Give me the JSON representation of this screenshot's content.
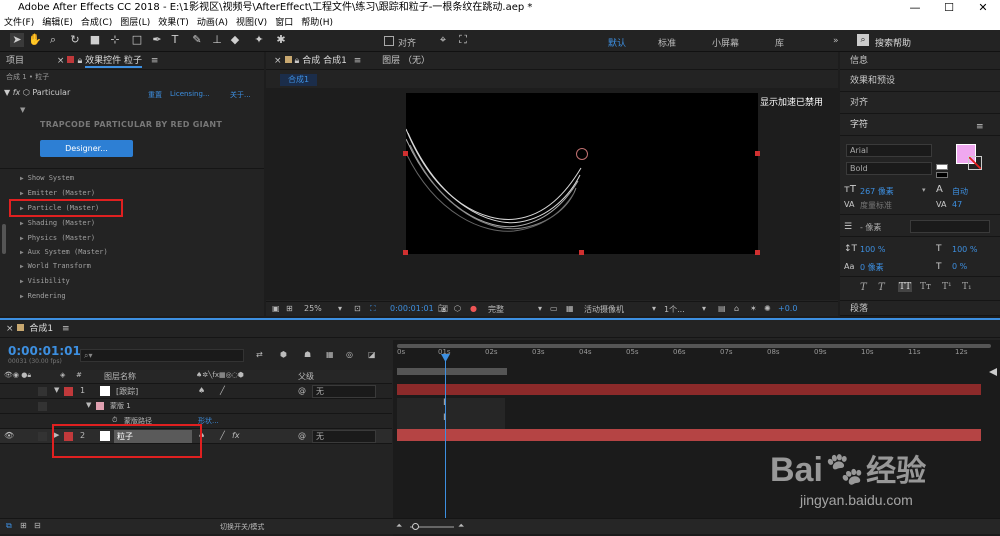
{
  "window": {
    "title": "Adobe After Effects CC 2018 - E:\\1影视区\\视频号\\AfterEffect\\工程文件\\练习\\跟踪和粒子-一根条纹在跳动.aep *",
    "app_icon": "Ae"
  },
  "menu": [
    "文件(F)",
    "编辑(E)",
    "合成(C)",
    "图层(L)",
    "效果(T)",
    "动画(A)",
    "视图(V)",
    "窗口",
    "帮助(H)"
  ],
  "toolbar": {
    "align_label": "对齐",
    "workspaces": [
      "默认",
      "标准",
      "小屏幕",
      "库"
    ],
    "search_placeholder": "搜索帮助"
  },
  "left_panel": {
    "tabs": [
      "项目",
      "效果控件 粒子"
    ],
    "breadcrumb": "合成 1 • 粒子",
    "effect_name": "Particular",
    "effect_links": [
      "重置",
      "Licensing...",
      "关于..."
    ],
    "brand": "TRAPCODE PARTICULAR BY RED GIANT",
    "designer_btn": "Designer...",
    "groups": [
      "Show System",
      "Emitter (Master)",
      "Particle (Master)",
      "Shading (Master)",
      "Physics (Master)",
      "Aux System (Master)",
      "World Transform",
      "Visibility",
      "Rendering"
    ]
  },
  "comp_panel": {
    "tab": "合成 合成1",
    "layer_tab": "图层 （无）",
    "sub_tab": "合成1",
    "notice": "显示加速已禁用",
    "zoom": "25%",
    "time": "0:00:01:01",
    "quality": "完整",
    "camera": "活动摄像机",
    "views": "1个...",
    "exposure": "+0.0"
  },
  "right_panel": {
    "items": [
      "信息",
      "效果和预设",
      "对齐",
      "字符"
    ],
    "font": "Arial",
    "style": "Bold",
    "size": "267 像素",
    "leading": "自动",
    "tracking_label": "度量标准",
    "tracking": "47",
    "stroke": "- 像素",
    "vscale": "100 %",
    "hscale": "100 %",
    "baseline": "0 像素",
    "tsume": "0 %",
    "paragraph": "段落",
    "style_btns": [
      "T",
      "T",
      "TT",
      "Tт",
      "T¹",
      "T₁"
    ],
    "fill_color": "#f0a8f0"
  },
  "timeline": {
    "tab": "合成1",
    "timecode": "0:00:01:01",
    "fps": "00031 (30.00 fps)",
    "col_name": "图层名称",
    "col_parent": "父级",
    "ticks": [
      "0s",
      "01s",
      "02s",
      "03s",
      "04s",
      "05s",
      "06s",
      "07s",
      "08s",
      "09s",
      "10s",
      "11s",
      "12s"
    ],
    "layers": [
      {
        "num": "1",
        "name": "[跟踪]",
        "parent": "无"
      },
      {
        "num": "2",
        "name": "粒子",
        "parent": "无"
      }
    ],
    "sub_rows": [
      "蒙版 1",
      "蒙版路径"
    ],
    "sub_value": "形状...",
    "mode_label": "切换开关/模式"
  },
  "watermark": {
    "brand": "Bai",
    "brand_cn": "经验",
    "url": "jingyan.baidu.com"
  },
  "highlight_color": "#e02020",
  "accent_color": "#3d8fe0"
}
